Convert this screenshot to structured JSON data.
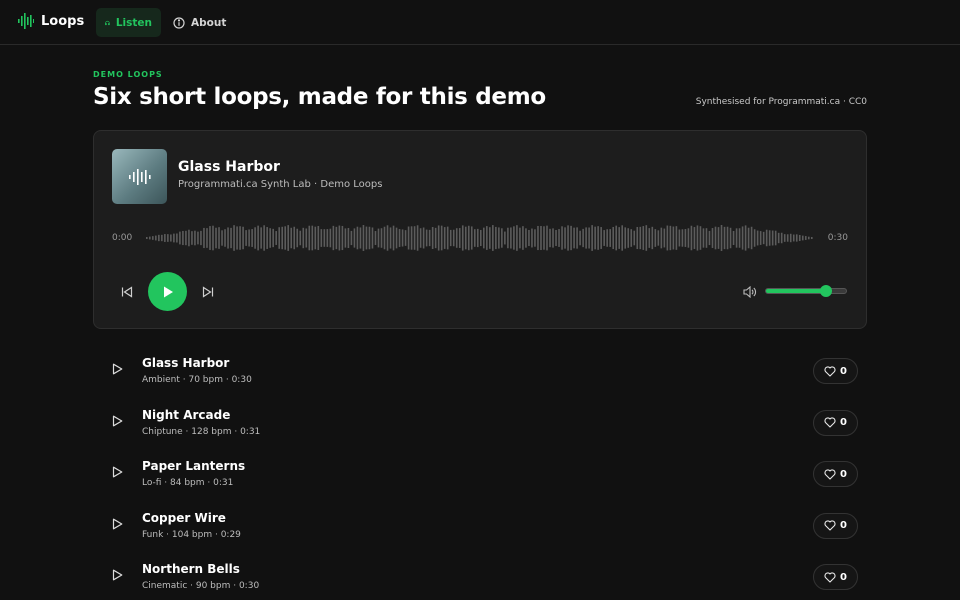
{
  "nav": {
    "brand": "Loops",
    "tabs": [
      {
        "label": "Listen",
        "icon": "headphones-icon",
        "active": true
      },
      {
        "label": "About",
        "icon": "info-icon",
        "active": false
      }
    ],
    "accent": "#22c55e"
  },
  "header": {
    "eyebrow": "DEMO LOOPS",
    "title": "Six short loops, made for this demo",
    "credit": "Synthesised for Programmati.ca · CC0"
  },
  "player": {
    "title": "Glass Harbor",
    "artist": "Programmati.ca Synth Lab · Demo Loops",
    "time_start": "0:00",
    "time_end": "0:30",
    "volume": 0.75
  },
  "tracks": [
    {
      "title": "Glass Harbor",
      "meta": "Ambient · 70 bpm · 0:30",
      "likes": "0"
    },
    {
      "title": "Night Arcade",
      "meta": "Chiptune · 128 bpm · 0:31",
      "likes": "0"
    },
    {
      "title": "Paper Lanterns",
      "meta": "Lo-fi · 84 bpm · 0:31",
      "likes": "0"
    },
    {
      "title": "Copper Wire",
      "meta": "Funk · 104 bpm · 0:29",
      "likes": "0"
    },
    {
      "title": "Northern Bells",
      "meta": "Cinematic · 90 bpm · 0:30",
      "likes": "0"
    }
  ]
}
